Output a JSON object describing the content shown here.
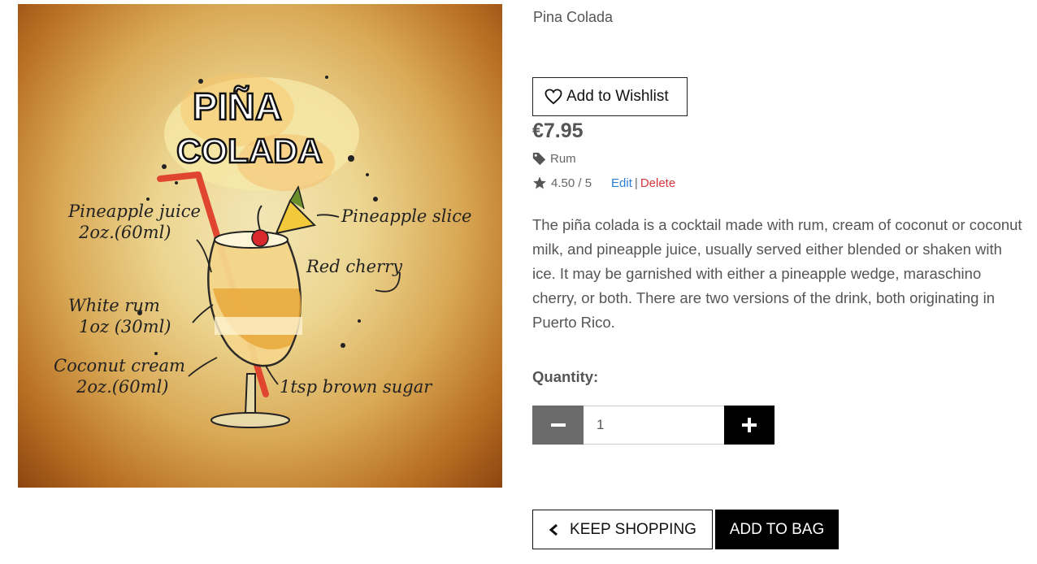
{
  "product": {
    "name": "Pina Colada",
    "image_alt": "Pina Colada cocktail illustration",
    "image_text": {
      "title_line1": "PIÑA",
      "title_line2": "COLADA",
      "label_pineapple_juice": "Pineapple juice",
      "label_pineapple_juice_amount": "2oz.(60ml)",
      "label_white_rum": "White rum",
      "label_white_rum_amount": "1oz (30ml)",
      "label_coconut_cream": "Coconut cream",
      "label_coconut_cream_amount": "2oz.(60ml)",
      "label_pineapple_slice": "Pineapple slice",
      "label_red_cherry": "Red cherry",
      "label_brown_sugar": "1tsp brown sugar"
    },
    "price": "€7.95",
    "category": "Rum",
    "rating": "4.50 / 5",
    "description": "The piña colada is a cocktail made with rum, cream of coconut or coconut milk, and pineapple juice, usually served either blended or shaken with ice. It may be garnished with either a pineapple wedge, maraschino cherry, or both. There are two versions of the drink, both originating in Puerto Rico."
  },
  "actions": {
    "wishlist_label": "Add to Wishlist",
    "edit_label": "Edit",
    "separator": "|",
    "delete_label": "Delete",
    "quantity_label": "Quantity:",
    "quantity_value": "1",
    "keep_shopping_label": "KEEP SHOPPING",
    "add_to_bag_label": "ADD TO BAG"
  },
  "icons": {
    "wishlist": "heart-icon",
    "category": "tag-icon",
    "rating": "star-icon",
    "minus": "minus-icon",
    "plus": "plus-icon",
    "back": "chevron-left-icon"
  },
  "colors": {
    "edit_link": "#2a7fd4",
    "delete_link": "#d9363e",
    "minus_button": "#6b6b6b",
    "plus_button": "#000000"
  }
}
